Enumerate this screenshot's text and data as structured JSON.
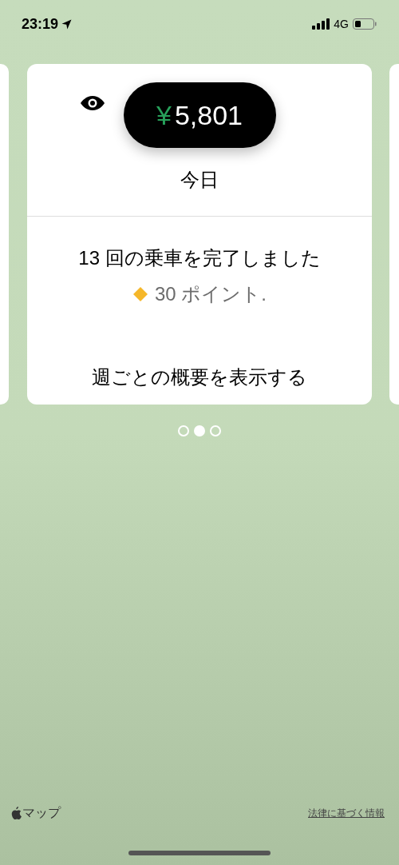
{
  "status_bar": {
    "time": "23:19",
    "network": "4G"
  },
  "card": {
    "currency": "¥",
    "amount": "5,801",
    "period": "今日",
    "rides_text": "13 回の乗車を完了しました",
    "points": "30 ポイント.",
    "link": "週ごとの概要を表示する"
  },
  "pager": [
    {
      "selected": false
    },
    {
      "selected": true
    },
    {
      "selected": false
    }
  ],
  "footer": {
    "maps_label": "マップ",
    "legal_link": "法律に基づく情報"
  }
}
